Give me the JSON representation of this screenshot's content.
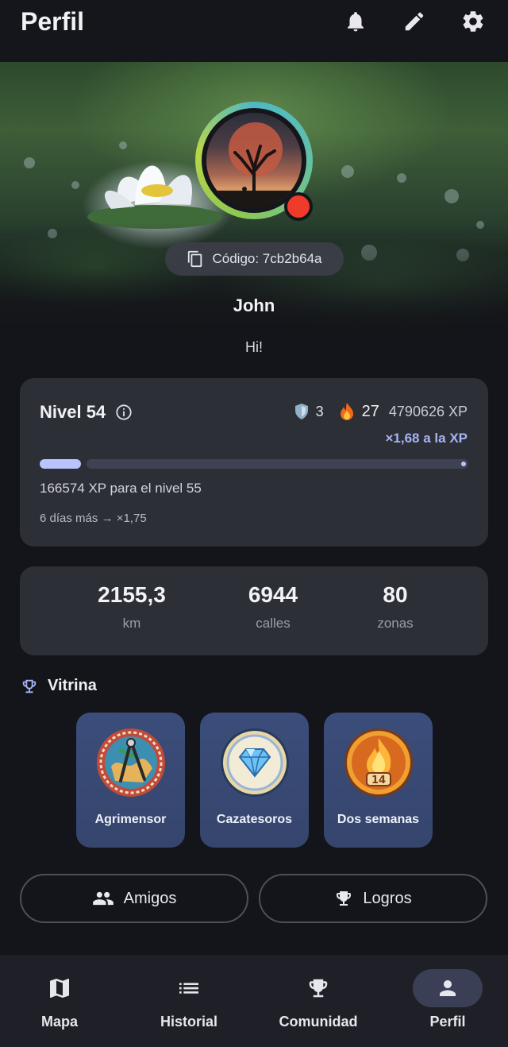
{
  "header": {
    "title": "Perfil",
    "icons": [
      "bell-icon",
      "pencil-icon",
      "gear-icon"
    ]
  },
  "profile": {
    "code_label": "Código: 7cb2b64a",
    "name": "John",
    "bio": "Hi!",
    "status_color": "#f03a2a"
  },
  "level": {
    "title": "Nivel 54",
    "shields": "3",
    "streak": "27",
    "xp_total": "4790626 XP",
    "multiplier": "×1,68 a la XP",
    "progress_fraction": 0.1,
    "to_next": "166574 XP para el nivel 55",
    "streak_note": "6 días más → ×1,75"
  },
  "stats": [
    {
      "value": "2155,3",
      "label": "km"
    },
    {
      "value": "6944",
      "label": "calles"
    },
    {
      "value": "80",
      "label": "zonas"
    }
  ],
  "showcase": {
    "title": "Vitrina",
    "badges": [
      {
        "label": "Agrimensor",
        "icon": "compass-medal-icon"
      },
      {
        "label": "Cazatesoros",
        "icon": "diamond-medal-icon"
      },
      {
        "label": "Dos semanas",
        "icon": "flame-medal-icon",
        "number": "14"
      }
    ]
  },
  "actions": {
    "friends": "Amigos",
    "achievements": "Logros"
  },
  "nav": {
    "items": [
      {
        "label": "Mapa",
        "icon": "map-icon"
      },
      {
        "label": "Historial",
        "icon": "list-icon"
      },
      {
        "label": "Comunidad",
        "icon": "trophy-icon"
      },
      {
        "label": "Perfil",
        "icon": "person-icon",
        "active": true
      }
    ]
  },
  "colors": {
    "accent": "#b9c4ff",
    "multiplier": "#a6b4f4",
    "card": "#2d2f37",
    "badge": "#3b4d7a"
  }
}
